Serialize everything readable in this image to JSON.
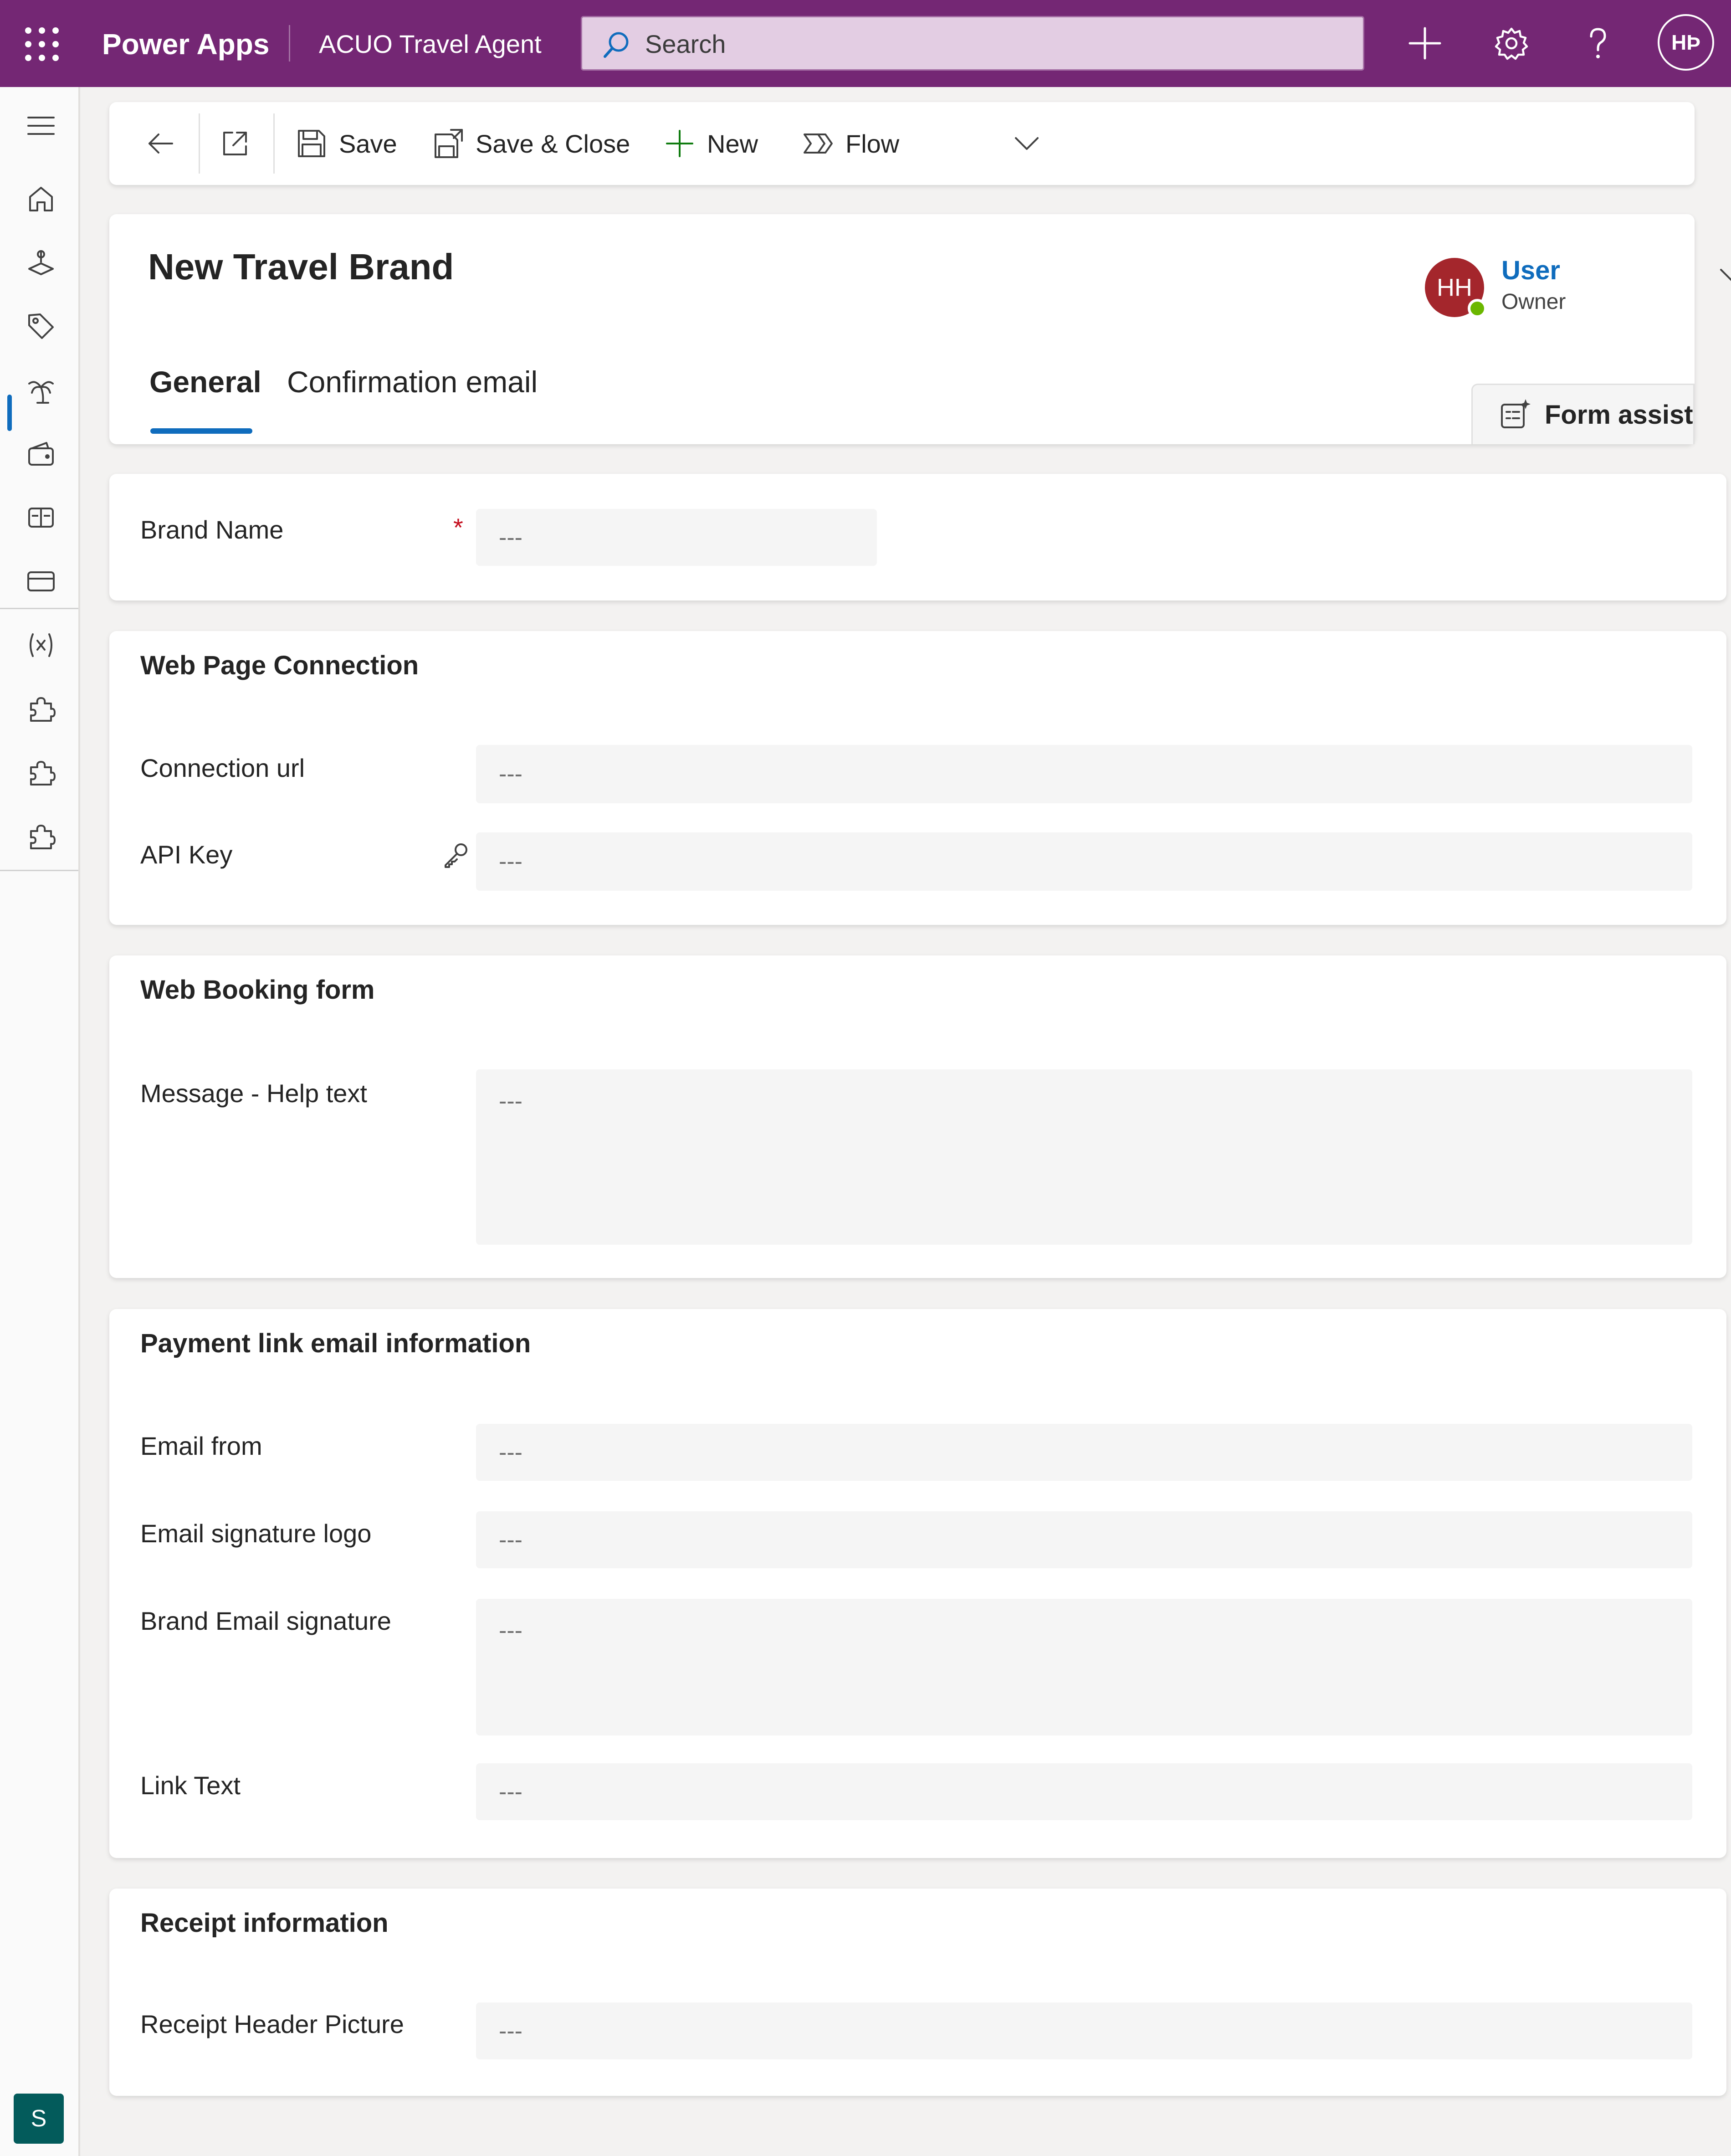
{
  "topbar": {
    "app_name": "Power Apps",
    "environment_name": "ACUO Travel Agent",
    "search_placeholder": "Search",
    "user_initials": "HÞ",
    "icons": [
      "app-launcher-icon",
      "search-icon",
      "plus-icon",
      "gear-icon",
      "help-icon"
    ]
  },
  "colors": {
    "brand": "#742774",
    "accent": "#0f6cbd",
    "required": "#c50f1f",
    "owner_avatar": "#a4262c",
    "presence": "#6bb700",
    "area_tile": "#035b5b"
  },
  "leftnav": {
    "items": [
      "home-icon",
      "map-pin-icon",
      "tag-icon",
      "palm-tree-icon",
      "wallet-icon",
      "ticket-icon",
      "card-icon",
      "variable-icon",
      "puzzle-icon",
      "puzzle-icon",
      "puzzle-icon"
    ],
    "active": "tag-icon",
    "area_initial": "S"
  },
  "commandbar": {
    "save": "Save",
    "save_close": "Save & Close",
    "new": "New",
    "flow": "Flow"
  },
  "header": {
    "title": "New Travel Brand",
    "owner_initials": "HH",
    "owner_name": "User",
    "owner_role": "Owner",
    "tabs": [
      {
        "label": "General",
        "selected": true
      },
      {
        "label": "Confirmation email",
        "selected": false
      }
    ],
    "form_assist": "Form assist"
  },
  "sections": {
    "brand": {
      "fields": [
        {
          "label": "Brand Name",
          "placeholder": "---",
          "required": true
        }
      ]
    },
    "web_page": {
      "title": "Web Page Connection",
      "fields": [
        {
          "label": "Connection url",
          "placeholder": "---"
        },
        {
          "label": "API Key",
          "placeholder": "---"
        }
      ]
    },
    "booking": {
      "title": "Web Booking form",
      "fields": [
        {
          "label": "Message - Help text",
          "placeholder": "---"
        }
      ]
    },
    "payment": {
      "title": "Payment link email information",
      "fields": [
        {
          "label": "Email from",
          "placeholder": "---"
        },
        {
          "label": "Email signature logo",
          "placeholder": "---"
        },
        {
          "label": "Brand Email signature",
          "placeholder": "---"
        },
        {
          "label": "Link Text",
          "placeholder": "---"
        }
      ]
    },
    "receipt": {
      "title": "Receipt information",
      "fields": [
        {
          "label": "Receipt Header Picture",
          "placeholder": "---"
        }
      ]
    }
  }
}
